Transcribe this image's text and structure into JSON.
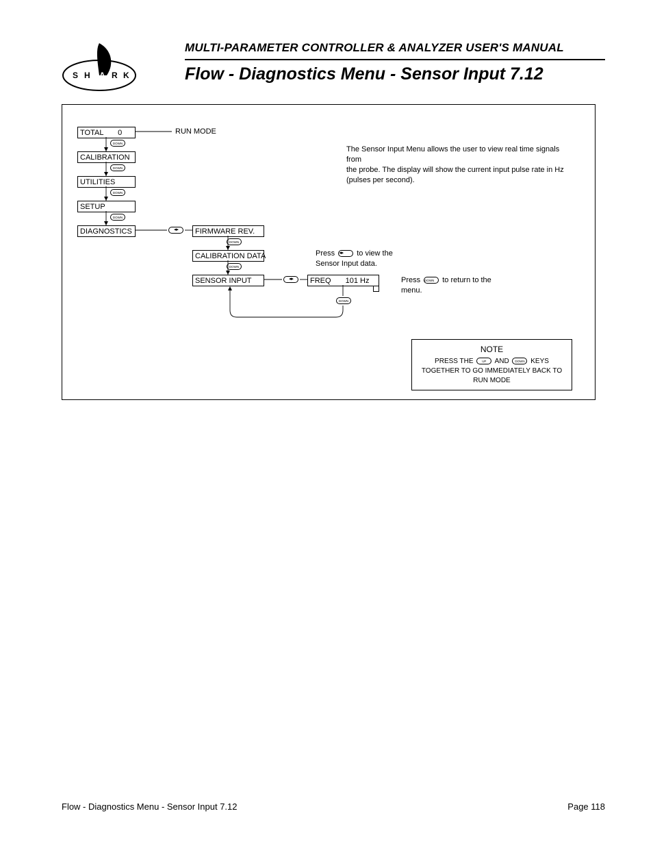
{
  "header": {
    "manual_title": "MULTI-PARAMETER CONTROLLER & ANALYZER USER'S MANUAL",
    "page_title": "Flow - Diagnostics Menu - Sensor Input 7.12",
    "logo_letters": [
      "S",
      "H",
      "A",
      "R",
      "K"
    ]
  },
  "menu": {
    "total": {
      "label": "TOTAL",
      "value": "0"
    },
    "run_mode": "RUN MODE",
    "calibration": "CALIBRATION",
    "utilities": "UTILITIES",
    "setup": "SETUP",
    "diagnostics": "DIAGNOSTICS",
    "firmware_rev": "FIRMWARE REV.",
    "calibration_data": "CALIBRATION DATA",
    "sensor_input": "SENSOR INPUT",
    "freq": {
      "label": "FREQ",
      "value": "101 Hz"
    }
  },
  "buttons": {
    "down": "DOWN",
    "up": "UP"
  },
  "text": {
    "intro_1": "The Sensor Input Menu allows the user to view real time signals from",
    "intro_2": "the probe. The display will show the current input pulse rate in Hz",
    "intro_3": "(pulses per second).",
    "press_view_1": "Press",
    "press_view_2": "to view the",
    "press_view_3": "Sensor Input data.",
    "press_return_1": "Press",
    "press_return_2": "to return to the",
    "press_return_3": "menu."
  },
  "note": {
    "title": "NOTE",
    "l1a": "PRESS THE",
    "l1b": "AND",
    "l1c": "KEYS",
    "l2": "TOGETHER TO GO IMMEDIATELY BACK TO",
    "l3": "RUN MODE"
  },
  "footer": {
    "left": "Flow - Diagnostics Menu - Sensor Input 7.12",
    "right": "Page 118"
  }
}
